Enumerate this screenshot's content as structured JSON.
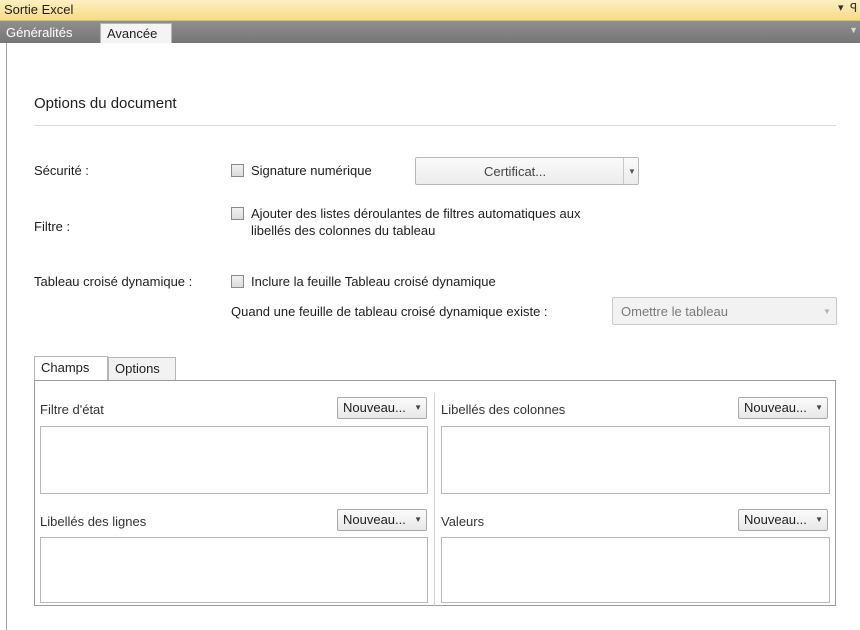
{
  "window": {
    "title": "Sortie Excel",
    "pin_glyphs": "▾ ꟼ"
  },
  "top_tabs": [
    {
      "label": "Généralités",
      "active": false
    },
    {
      "label": "Avancée",
      "active": true
    }
  ],
  "section": {
    "title": "Options du document"
  },
  "security": {
    "label": "Sécurité :",
    "checkbox_label": "Signature numérique",
    "checked": false,
    "certificate_button": "Certificat...",
    "dropdown_icon": "chevron-down-icon"
  },
  "filter": {
    "label": "Filtre :",
    "checkbox_label_line1": "Ajouter des listes déroulantes de filtres automatiques aux",
    "checkbox_label_line2": "libellés des colonnes du tableau",
    "checked": false
  },
  "pivot": {
    "label": "Tableau croisé dynamique :",
    "checkbox_label": "Inclure la feuille Tableau croisé dynamique",
    "checked": false,
    "exists_label": "Quand une feuille de tableau croisé dynamique existe :",
    "exists_value": "Omettre le tableau"
  },
  "inner_tabs": [
    {
      "label": "Champs",
      "active": true
    },
    {
      "label": "Options",
      "active": false
    }
  ],
  "zones": {
    "report_filter": {
      "label": "Filtre d'état",
      "button": "Nouveau..."
    },
    "column_labels": {
      "label": "Libellés des colonnes",
      "button": "Nouveau..."
    },
    "row_labels": {
      "label": "Libellés des lignes",
      "button": "Nouveau..."
    },
    "values": {
      "label": "Valeurs",
      "button": "Nouveau..."
    }
  },
  "colors": {
    "titlebar": "#f7dc85",
    "tabstrip": "#808080",
    "panel_border": "#9a9a9a"
  }
}
